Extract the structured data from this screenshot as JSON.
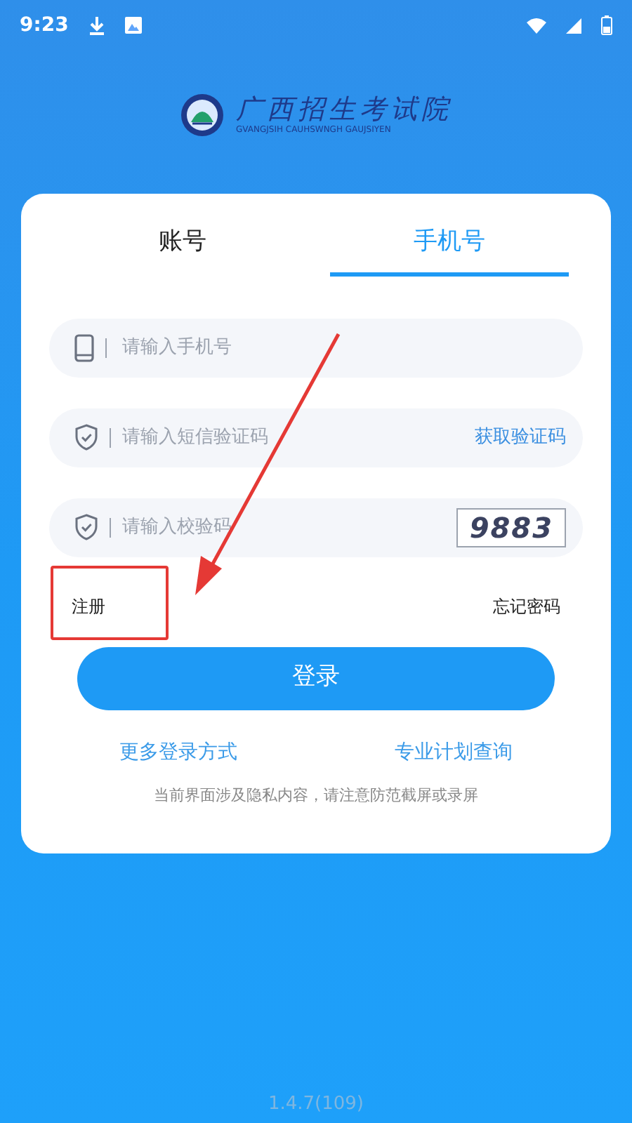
{
  "status_bar": {
    "time": "9:23"
  },
  "logo": {
    "title": "广西招生考试院",
    "subtitle": "GVANGJSIH CAUHSWNGH GAUJSIYEN"
  },
  "tabs": [
    {
      "label": "账号",
      "selected": false
    },
    {
      "label": "手机号",
      "selected": true
    }
  ],
  "fields": [
    {
      "kind": "phone",
      "placeholder": "请输入手机号"
    },
    {
      "kind": "sms",
      "placeholder": "请输入短信验证码",
      "action": "获取验证码"
    },
    {
      "kind": "captcha",
      "placeholder": "请输入校验码",
      "captcha": "9883"
    }
  ],
  "register_link": "注册",
  "forgot_link": "忘记密码",
  "login_button": "登录",
  "links": [
    "更多登录方式",
    "专业计划查询"
  ],
  "notice": "当前界面涉及隐私内容，请注意防范截屏或录屏",
  "version": "1.4.7(109)"
}
